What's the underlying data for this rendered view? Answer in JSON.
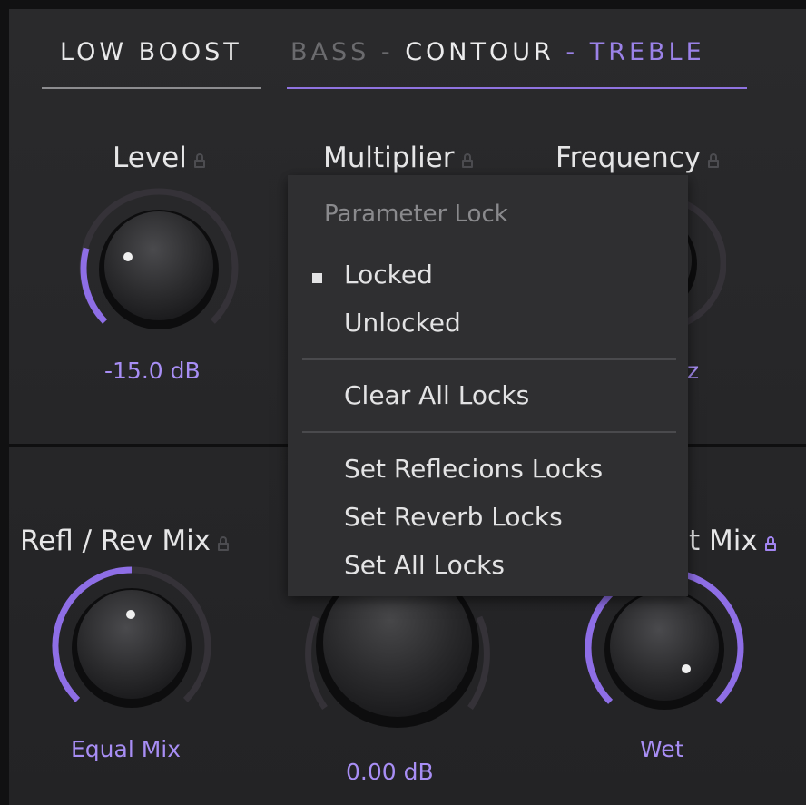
{
  "tabs": {
    "low_boost": "LOW BOOST",
    "bass": "BASS",
    "sep1": " - ",
    "contour": "CONTOUR",
    "sep2": " - ",
    "treble": "TREBLE"
  },
  "params": {
    "level": {
      "label": "Level",
      "value": "-15.0 dB",
      "locked": false,
      "level_fraction": 0.18
    },
    "multiplier": {
      "label": "Multiplier",
      "locked": false
    },
    "frequency": {
      "label": "Frequency",
      "value_partial": "z",
      "locked": false
    },
    "refl_rev_mix": {
      "label": "Refl / Rev Mix",
      "value": "Equal Mix",
      "locked": false,
      "level_fraction": 0.5
    },
    "center_knob": {
      "value": "0.00 dB"
    },
    "dry_wet_mix": {
      "label_partial": "t Mix",
      "value": "Wet",
      "locked": true,
      "level_fraction": 1.0
    }
  },
  "menu": {
    "header": "Parameter Lock",
    "locked": "Locked",
    "unlocked": "Unlocked",
    "clear_all": "Clear All Locks",
    "set_reflections": "Set Reflecions Locks",
    "set_reverb": "Set Reverb Locks",
    "set_all": "Set All Locks",
    "selected": "Locked"
  },
  "colors": {
    "accent": "#9b82e8",
    "value_text": "#a88ef5",
    "panel": "#28282a",
    "menu_bg": "#2f2f31"
  }
}
